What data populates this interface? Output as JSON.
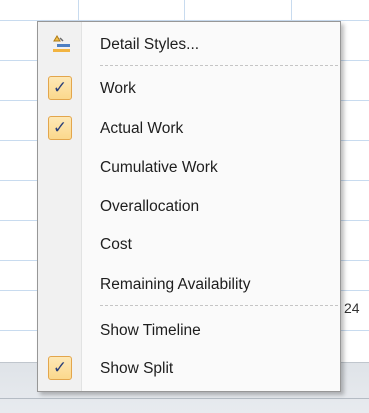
{
  "background": {
    "partial_number": "24"
  },
  "menu": {
    "items": [
      {
        "label": "Detail Styles...",
        "checked": false,
        "icon": "detail-styles-icon"
      },
      {
        "label": "Work",
        "checked": true
      },
      {
        "label": "Actual Work",
        "checked": true
      },
      {
        "label": "Cumulative Work",
        "checked": false
      },
      {
        "label": "Overallocation",
        "checked": false
      },
      {
        "label": "Cost",
        "checked": false
      },
      {
        "label": "Remaining Availability",
        "checked": false
      },
      {
        "label": "Show Timeline",
        "checked": false
      },
      {
        "label": "Show Split",
        "checked": true
      }
    ],
    "check_glyph": "✓",
    "colors": {
      "check_bg": "#fbd88c",
      "check_border": "#e3a64c",
      "check_mark": "#2a3f7a"
    }
  }
}
